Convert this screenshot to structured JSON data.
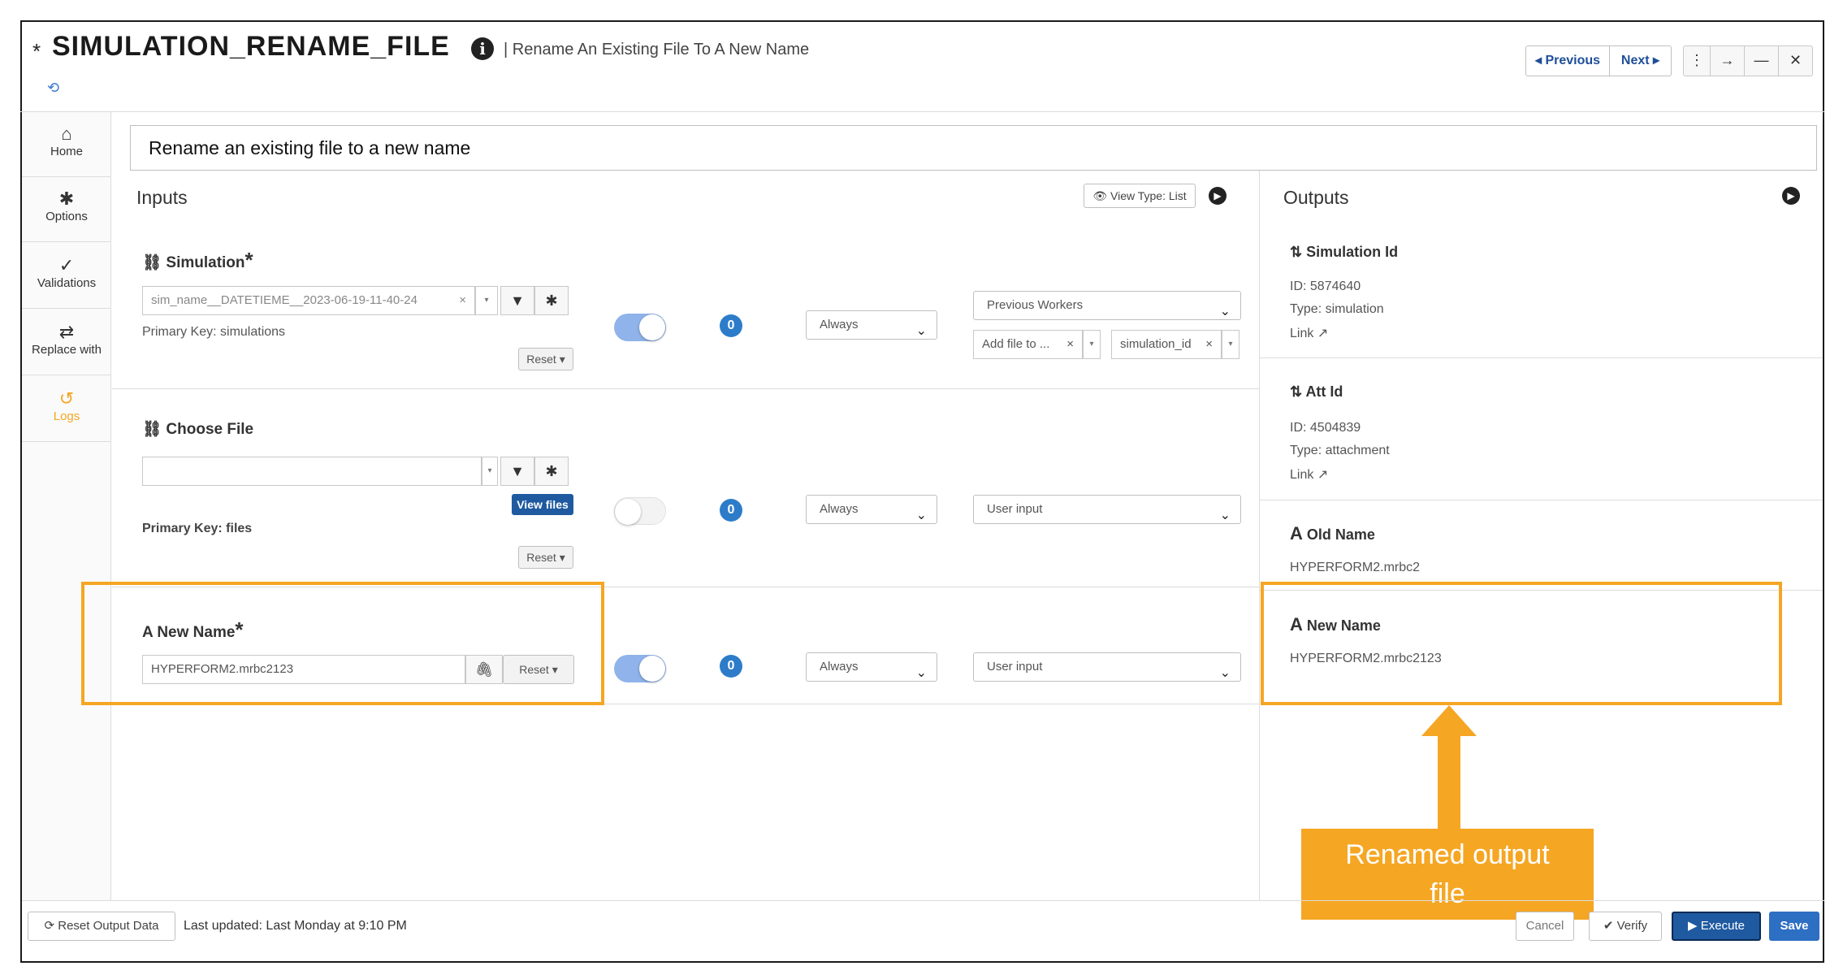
{
  "header": {
    "star": "*",
    "title": "SIMULATION_RENAME_FILE",
    "info_icon": "info-circle-icon",
    "subtitle": "| Rename An Existing File To A New Name",
    "previous_label": "◂ Previous",
    "next_label": "Next ▸"
  },
  "sidebar": {
    "items": [
      {
        "label": "Home",
        "icon": "home-icon"
      },
      {
        "label": "Options",
        "icon": "gear-icon"
      },
      {
        "label": "Validations",
        "icon": "check-icon"
      },
      {
        "label": "Replace with",
        "icon": "swap-icon"
      },
      {
        "label": "Logs",
        "icon": "history-icon",
        "active_color": "#f5a623"
      }
    ]
  },
  "description": "Rename an existing file to a new name",
  "inputs": {
    "title": "Inputs",
    "view_type": "View Type: List",
    "simulation": {
      "label": "Simulation",
      "required": "*",
      "value": "sim_name__DATETIEME__2023-06-19-11-40-24",
      "clear": "×",
      "primary_key": "Primary Key: simulations",
      "reset": "Reset ▾",
      "toggle_on": true,
      "count": "0",
      "mode": "Always",
      "source": "Previous Workers",
      "add_file": "Add file to ...",
      "add_file_clear": "×",
      "sim_id": "simulation_id",
      "sim_id_clear": "×"
    },
    "choose_file": {
      "label": "Choose File",
      "value": "",
      "view_files": "View files",
      "primary_key": "Primary Key: files",
      "reset": "Reset ▾",
      "toggle_on": false,
      "count": "0",
      "mode": "Always",
      "source": "User input"
    },
    "new_name": {
      "label": "New Name",
      "required": "*",
      "value": "HYPERFORM2.mrbc2123",
      "reset": "Reset ▾",
      "toggle_on": true,
      "count": "0",
      "mode": "Always",
      "source": "User input"
    }
  },
  "outputs": {
    "title": "Outputs",
    "simulation_id": {
      "label": "Simulation Id",
      "id": "ID: 5874640",
      "type": "Type: simulation",
      "link": "Link"
    },
    "att_id": {
      "label": "Att Id",
      "id": "ID: 4504839",
      "type": "Type: attachment",
      "link": "Link"
    },
    "old_name": {
      "label": "Old Name",
      "value": "HYPERFORM2.mrbc2"
    },
    "new_name": {
      "label": "New Name",
      "value": "HYPERFORM2.mrbc2123"
    }
  },
  "callout": {
    "line1": "Renamed output",
    "line2": "file",
    "color": "#f5a623"
  },
  "footer": {
    "reset_output": "Reset Output Data",
    "last_updated": "Last updated: Last Monday at 9:10 PM",
    "cancel": "Cancel",
    "verify": "Verify",
    "execute": "Execute",
    "save": "Save"
  }
}
